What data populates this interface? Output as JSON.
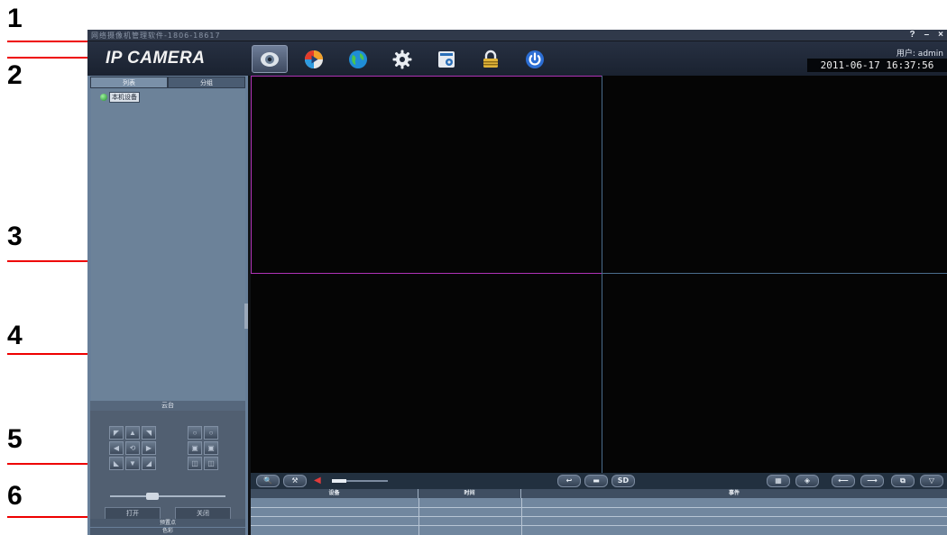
{
  "callouts": [
    "1",
    "2",
    "3",
    "4",
    "5",
    "6"
  ],
  "app": {
    "title_text": "网络摄像机管理软件-1806-18617",
    "window_controls": {
      "help": "?",
      "minimize": "–",
      "close": "×"
    },
    "logo": "IP CAMERA",
    "toolbar": [
      {
        "icon": "camera-icon",
        "active": true
      },
      {
        "icon": "playback-icon",
        "active": false
      },
      {
        "icon": "globe-icon",
        "active": false
      },
      {
        "icon": "gear-icon",
        "active": false
      },
      {
        "icon": "image-icon",
        "active": false
      },
      {
        "icon": "lock-icon",
        "active": false
      },
      {
        "icon": "power-icon",
        "active": false
      }
    ],
    "user_label": "用户: admin",
    "datetime": "2011-06-17 16:37:56"
  },
  "left_panel": {
    "tabs": [
      "列表",
      "分组"
    ],
    "active_tab": 0,
    "device_tree": {
      "root_label": "本机设备"
    },
    "ptz": {
      "header": "云台",
      "buttons": [
        "◤",
        "▲",
        "◥",
        "◀",
        "⟲",
        "▶",
        "◣",
        "▼",
        "◢"
      ],
      "zoom_focus": [
        "○",
        "○",
        "▣",
        "▣",
        "◫",
        "◫"
      ],
      "action_left": "打开",
      "action_right": "关闭"
    },
    "preset_label": "预置点",
    "color_label": "色彩"
  },
  "video_grid": {
    "layout": "2x2",
    "selected_cell": 0
  },
  "controls": {
    "search": "🔍",
    "tools": "⚒",
    "volume_icon": "◀",
    "volume": 0.25,
    "snap_back": "↩",
    "record": "▬",
    "sd": "SD",
    "layout": "▦",
    "ptz_toggle": "◈",
    "prev": "⟵",
    "next": "⟶",
    "cycle": "⧉",
    "more": "▽"
  },
  "event_log": {
    "columns": [
      "设备",
      "时间",
      "事件"
    ]
  }
}
